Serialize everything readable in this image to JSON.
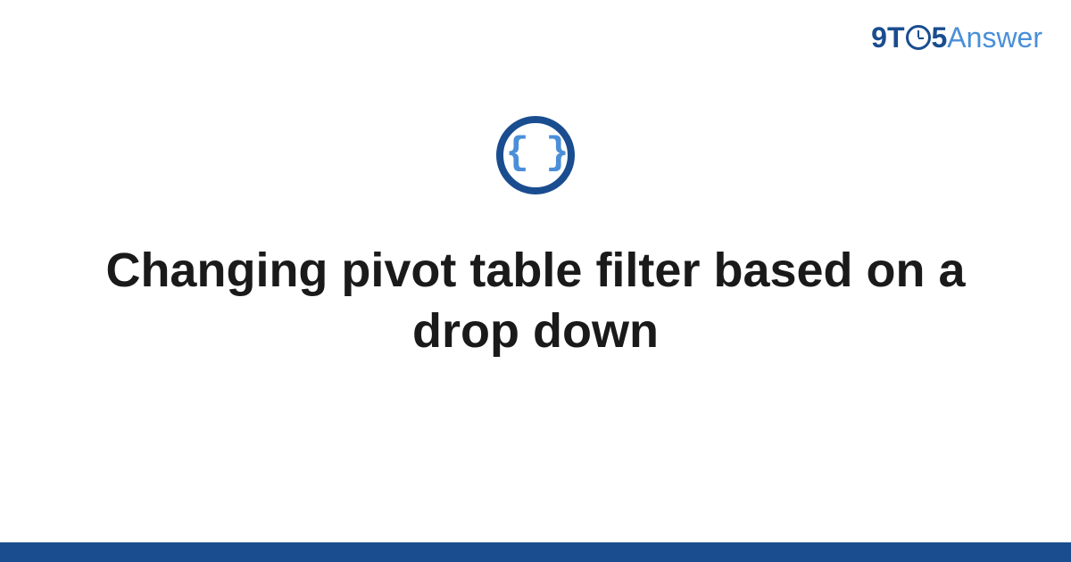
{
  "logo": {
    "part1": "9T",
    "part2": "5",
    "part3": "Answer"
  },
  "icon": {
    "glyph": "{ }",
    "name": "code-braces-icon"
  },
  "title": "Changing pivot table filter based on a drop down",
  "colors": {
    "primary": "#1a4d8f",
    "accent": "#4a8fd8",
    "text": "#1a1a1a",
    "background": "#ffffff"
  }
}
